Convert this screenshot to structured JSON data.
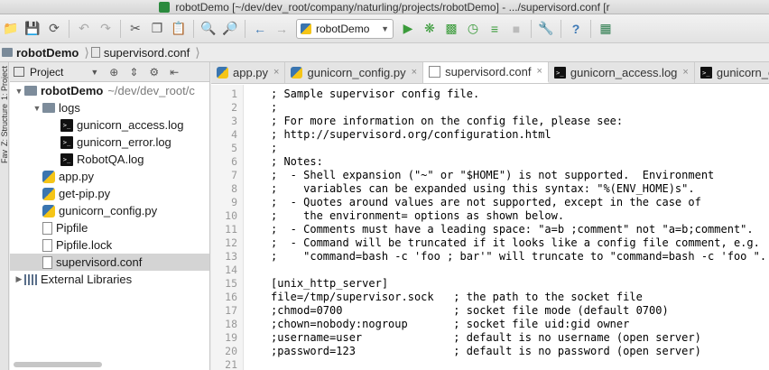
{
  "window": {
    "title": "robotDemo [~/dev/dev_root/company/naturling/projects/robotDemo] - .../supervisord.conf [r"
  },
  "toolbar": {
    "run_config": "robotDemo"
  },
  "breadcrumb": [
    "robotDemo",
    "supervisord.conf"
  ],
  "sidebar_strip": [
    "1: Project",
    "Z: Structure",
    "Fav"
  ],
  "project_panel": {
    "header": "Project",
    "tree": [
      {
        "name": "robotDemo",
        "detail": "~/dev/dev_root/c",
        "type": "folder",
        "depth": 0,
        "expanded": true,
        "bold": true
      },
      {
        "name": "logs",
        "type": "folder",
        "depth": 1,
        "expanded": true
      },
      {
        "name": "gunicorn_access.log",
        "type": "log",
        "depth": 2
      },
      {
        "name": "gunicorn_error.log",
        "type": "log",
        "depth": 2
      },
      {
        "name": "RobotQA.log",
        "type": "log",
        "depth": 2
      },
      {
        "name": "app.py",
        "type": "py",
        "depth": 1
      },
      {
        "name": "get-pip.py",
        "type": "py",
        "depth": 1
      },
      {
        "name": "gunicorn_config.py",
        "type": "py",
        "depth": 1
      },
      {
        "name": "Pipfile",
        "type": "txt",
        "depth": 1
      },
      {
        "name": "Pipfile.lock",
        "type": "txt",
        "depth": 1
      },
      {
        "name": "supervisord.conf",
        "type": "cfg",
        "depth": 1,
        "selected": true
      },
      {
        "name": "External Libraries",
        "type": "lib",
        "depth": 0,
        "collapsed": true
      }
    ]
  },
  "editor": {
    "tabs": [
      {
        "label": "app.py",
        "type": "py",
        "active": false
      },
      {
        "label": "gunicorn_config.py",
        "type": "py",
        "active": false
      },
      {
        "label": "supervisord.conf",
        "type": "cfg",
        "active": true
      },
      {
        "label": "gunicorn_access.log",
        "type": "log",
        "active": false
      },
      {
        "label": "gunicorn_erro",
        "type": "log",
        "active": false
      }
    ],
    "lines": [
      "; Sample supervisor config file.",
      ";",
      "; For more information on the config file, please see:",
      "; http://supervisord.org/configuration.html",
      ";",
      "; Notes:",
      ";  - Shell expansion (\"~\" or \"$HOME\") is not supported.  Environment",
      ";    variables can be expanded using this syntax: \"%(ENV_HOME)s\".",
      ";  - Quotes around values are not supported, except in the case of",
      ";    the environment= options as shown below.",
      ";  - Comments must have a leading space: \"a=b ;comment\" not \"a=b;comment\".",
      ";  - Command will be truncated if it looks like a config file comment, e.g.",
      ";    \"command=bash -c 'foo ; bar'\" will truncate to \"command=bash -c 'foo \".",
      "",
      "[unix_http_server]",
      "file=/tmp/supervisor.sock   ; the path to the socket file",
      ";chmod=0700                 ; socket file mode (default 0700)",
      ";chown=nobody:nogroup       ; socket file uid:gid owner",
      ";username=user              ; default is no username (open server)",
      ";password=123               ; default is no password (open server)",
      ""
    ],
    "line_numbers": [
      "1",
      "2",
      "3",
      "4",
      "5",
      "6",
      "7",
      "8",
      "9",
      "10",
      "11",
      "12",
      "13",
      "14",
      "15",
      "16",
      "17",
      "18",
      "19",
      "20",
      "21"
    ]
  }
}
